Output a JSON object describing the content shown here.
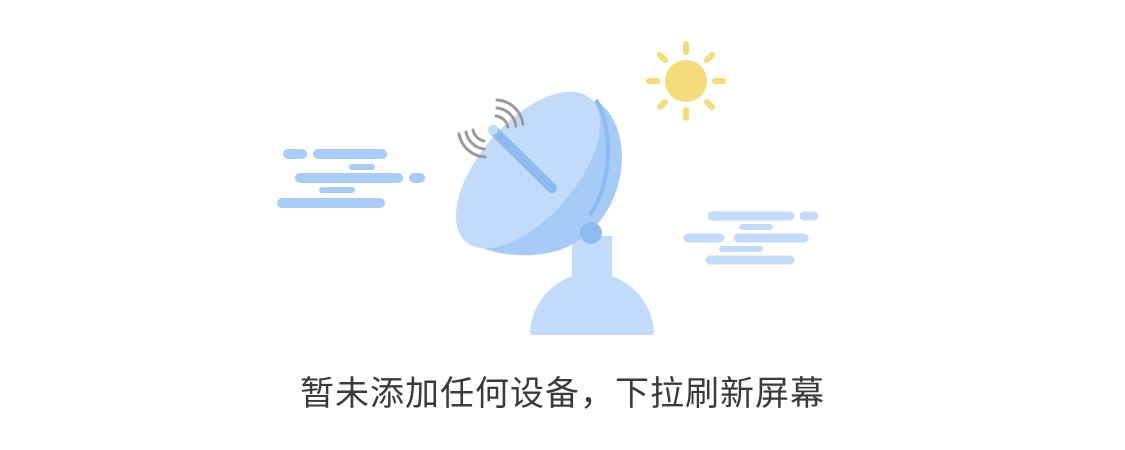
{
  "empty_state": {
    "message": "暂未添加任何设备，下拉刷新屏幕"
  },
  "illustration": {
    "icons": [
      "satellite-dish-icon",
      "sun-icon",
      "cloud-icon",
      "signal-waves-icon"
    ],
    "colors": {
      "dish_light": "#c2dbfa",
      "dish_mid": "#a7cbf6",
      "dish_dark": "#8dbaf1",
      "cloud_left": "#a9cbf6",
      "cloud_right": "#c4dbfa",
      "sun": "#f5dc7a",
      "signal": "#9a9a9a",
      "text": "#3a3a3a"
    }
  }
}
